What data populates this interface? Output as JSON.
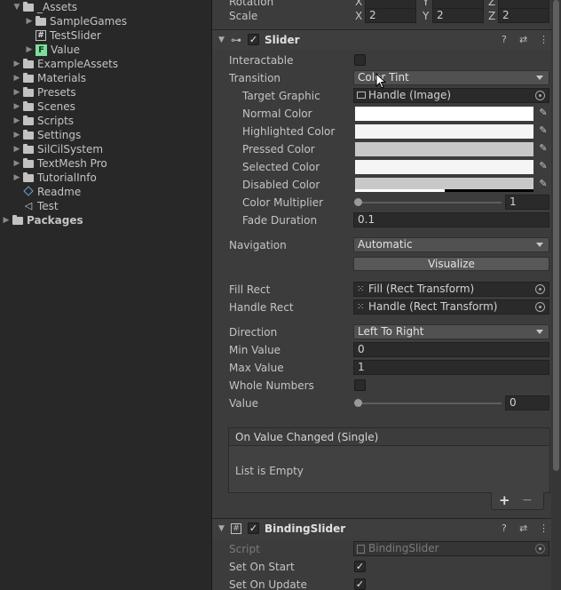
{
  "project": {
    "items": [
      {
        "label": "_Assets",
        "icon": "folder-icon",
        "indent": 1,
        "expanded": true
      },
      {
        "label": "SampleGames",
        "icon": "folder-icon",
        "indent": 2,
        "expanded": false
      },
      {
        "label": "TestSlider",
        "icon": "script-icon",
        "indent": 2
      },
      {
        "label": "Value",
        "icon": "f-asset-icon",
        "indent": 2,
        "expanded": false
      },
      {
        "label": "ExampleAssets",
        "icon": "folder-icon",
        "indent": 1,
        "expanded": false
      },
      {
        "label": "Materials",
        "icon": "folder-icon",
        "indent": 1,
        "expanded": false
      },
      {
        "label": "Presets",
        "icon": "folder-icon",
        "indent": 1,
        "expanded": false
      },
      {
        "label": "Scenes",
        "icon": "folder-icon",
        "indent": 1,
        "expanded": false
      },
      {
        "label": "Scripts",
        "icon": "folder-icon",
        "indent": 1,
        "expanded": false
      },
      {
        "label": "Settings",
        "icon": "folder-icon",
        "indent": 1,
        "expanded": false
      },
      {
        "label": "SilCilSystem",
        "icon": "folder-icon",
        "indent": 1,
        "expanded": false
      },
      {
        "label": "TextMesh Pro",
        "icon": "folder-icon",
        "indent": 1,
        "expanded": false
      },
      {
        "label": "TutorialInfo",
        "icon": "folder-icon",
        "indent": 1,
        "expanded": false
      },
      {
        "label": "Readme",
        "icon": "readme-icon",
        "indent": 1
      },
      {
        "label": "Test",
        "icon": "unity-scene-icon",
        "indent": 1
      },
      {
        "label": "Packages",
        "icon": "folder-icon",
        "indent": 0,
        "expanded": false
      }
    ]
  },
  "transform": {
    "rotation_label": "Rotation",
    "scale_label": "Scale",
    "x_label": "X",
    "y_label": "Y",
    "z_label": "Z",
    "scale_x": "2",
    "scale_y": "2",
    "scale_z": "2"
  },
  "slider": {
    "title": "Slider",
    "interactable_label": "Interactable",
    "transition_label": "Transition",
    "transition_value": "Color Tint",
    "target_graphic_label": "Target Graphic",
    "target_graphic_value": "Handle (Image)",
    "normal_color_label": "Normal Color",
    "highlighted_color_label": "Highlighted Color",
    "pressed_color_label": "Pressed Color",
    "selected_color_label": "Selected Color",
    "disabled_color_label": "Disabled Color",
    "color_multiplier_label": "Color Multiplier",
    "color_multiplier_value": "1",
    "color_multiplier_fraction": 0,
    "fade_duration_label": "Fade Duration",
    "fade_duration_value": "0.1",
    "navigation_label": "Navigation",
    "navigation_value": "Automatic",
    "visualize_label": "Visualize",
    "fill_rect_label": "Fill Rect",
    "fill_rect_value": "Fill (Rect Transform)",
    "handle_rect_label": "Handle Rect",
    "handle_rect_value": "Handle (Rect Transform)",
    "direction_label": "Direction",
    "direction_value": "Left To Right",
    "min_value_label": "Min Value",
    "min_value": "0",
    "max_value_label": "Max Value",
    "max_value": "1",
    "whole_numbers_label": "Whole Numbers",
    "value_label": "Value",
    "value": "0",
    "event_title": "On Value Changed (Single)",
    "event_empty": "List is Empty",
    "plus": "+",
    "minus": "−"
  },
  "binding": {
    "title": "BindingSlider",
    "script_label": "Script",
    "script_value": "BindingSlider",
    "set_on_start_label": "Set On Start",
    "set_on_update_label": "Set On Update"
  },
  "colors": {
    "normal": "#ffffff",
    "highlighted": "#f5f5f5",
    "pressed": "#c8c8c8",
    "selected": "#f5f5f5",
    "disabled": "#c8c8c8",
    "disabled_alpha_fraction": 0.5
  }
}
